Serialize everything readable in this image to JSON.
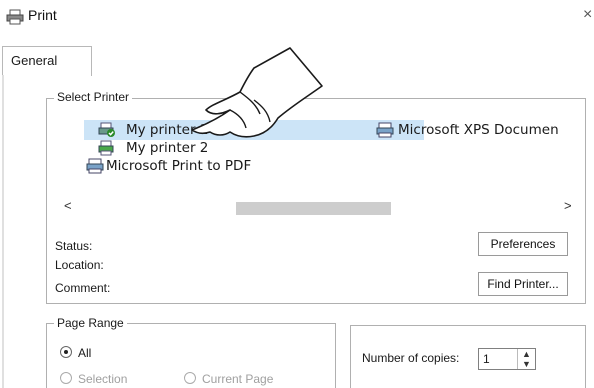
{
  "window": {
    "title": "Print",
    "close_glyph": "×"
  },
  "tabs": [
    {
      "label": "General"
    }
  ],
  "select_printer": {
    "group_label": "Select Printer",
    "printers": [
      {
        "name": "My printer 1",
        "icon": "printer-icon-checked",
        "selected": true
      },
      {
        "name": "My printer 2",
        "icon": "printer-icon-green"
      },
      {
        "name": "Microsoft Print to PDF",
        "icon": "printer-icon"
      },
      {
        "name": "Microsoft XPS Documen",
        "icon": "printer-icon"
      }
    ],
    "scroll_left": "<",
    "scroll_right": ">",
    "status_label": "Status:",
    "location_label": "Location:",
    "comment_label": "Comment:",
    "preferences_button": "Preferences",
    "find_printer_button": "Find Printer..."
  },
  "page_range": {
    "group_label": "Page Range",
    "options": {
      "all": "All",
      "selection": "Selection",
      "current_page": "Current Page"
    }
  },
  "copies": {
    "label": "Number of copies:",
    "value": "1",
    "spin_up": "▲",
    "spin_down": "▼"
  },
  "colors": {
    "selection_bg": "#cce4f7",
    "border": "#b0b0b0"
  }
}
